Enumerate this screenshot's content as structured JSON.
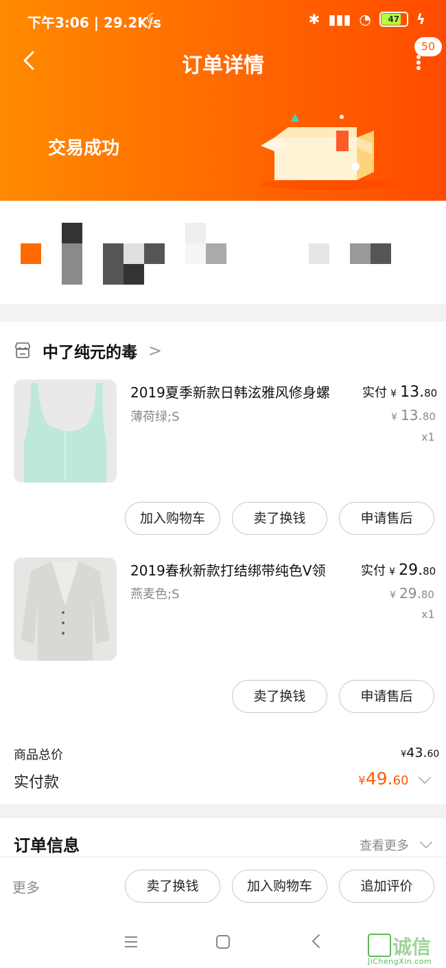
{
  "status_bar": {
    "time_speed": "下午3:06 | 29.2K/s",
    "battery": "47"
  },
  "nav": {
    "title": "订单详情",
    "badge": "50"
  },
  "order": {
    "status": "交易成功"
  },
  "shop": {
    "name": "中了纯元的毒"
  },
  "items": [
    {
      "title": "2019夏季新款日韩泫雅风修身螺",
      "spec": "薄荷绿;S",
      "paid_label": "实付",
      "paid_yen": "¥",
      "paid_int": "13.",
      "paid_dec": "80",
      "orig_yen": "¥",
      "orig_int": "13.",
      "orig_dec": "80",
      "qty": "x1",
      "buttons": [
        "加入购物车",
        "卖了换钱",
        "申请售后"
      ]
    },
    {
      "title": "2019春秋新款打结绑带纯色V领",
      "spec": "燕麦色;S",
      "paid_label": "实付",
      "paid_yen": "¥",
      "paid_int": "29.",
      "paid_dec": "80",
      "orig_yen": "¥",
      "orig_int": "29.",
      "orig_dec": "80",
      "qty": "x1",
      "buttons": [
        "卖了换钱",
        "申请售后"
      ]
    }
  ],
  "totals": {
    "goods_total_label": "商品总价",
    "goods_total_yen": "¥",
    "goods_total_int": "43.",
    "goods_total_dec": "60",
    "paid_label": "实付款",
    "paid_yen": "¥",
    "paid_int": "49.",
    "paid_dec": "60"
  },
  "order_info": {
    "title": "订单信息",
    "see_more": "查看更多"
  },
  "bottom_bar": {
    "more": "更多",
    "buttons": [
      "卖了换钱",
      "加入购物车",
      "追加评价"
    ]
  },
  "watermark": {
    "text": "诚信",
    "url": "JiChengXin.com"
  },
  "colors": {
    "accent": "#ff5a00",
    "header_start": "#ff8a00",
    "header_end": "#ff4b00"
  }
}
